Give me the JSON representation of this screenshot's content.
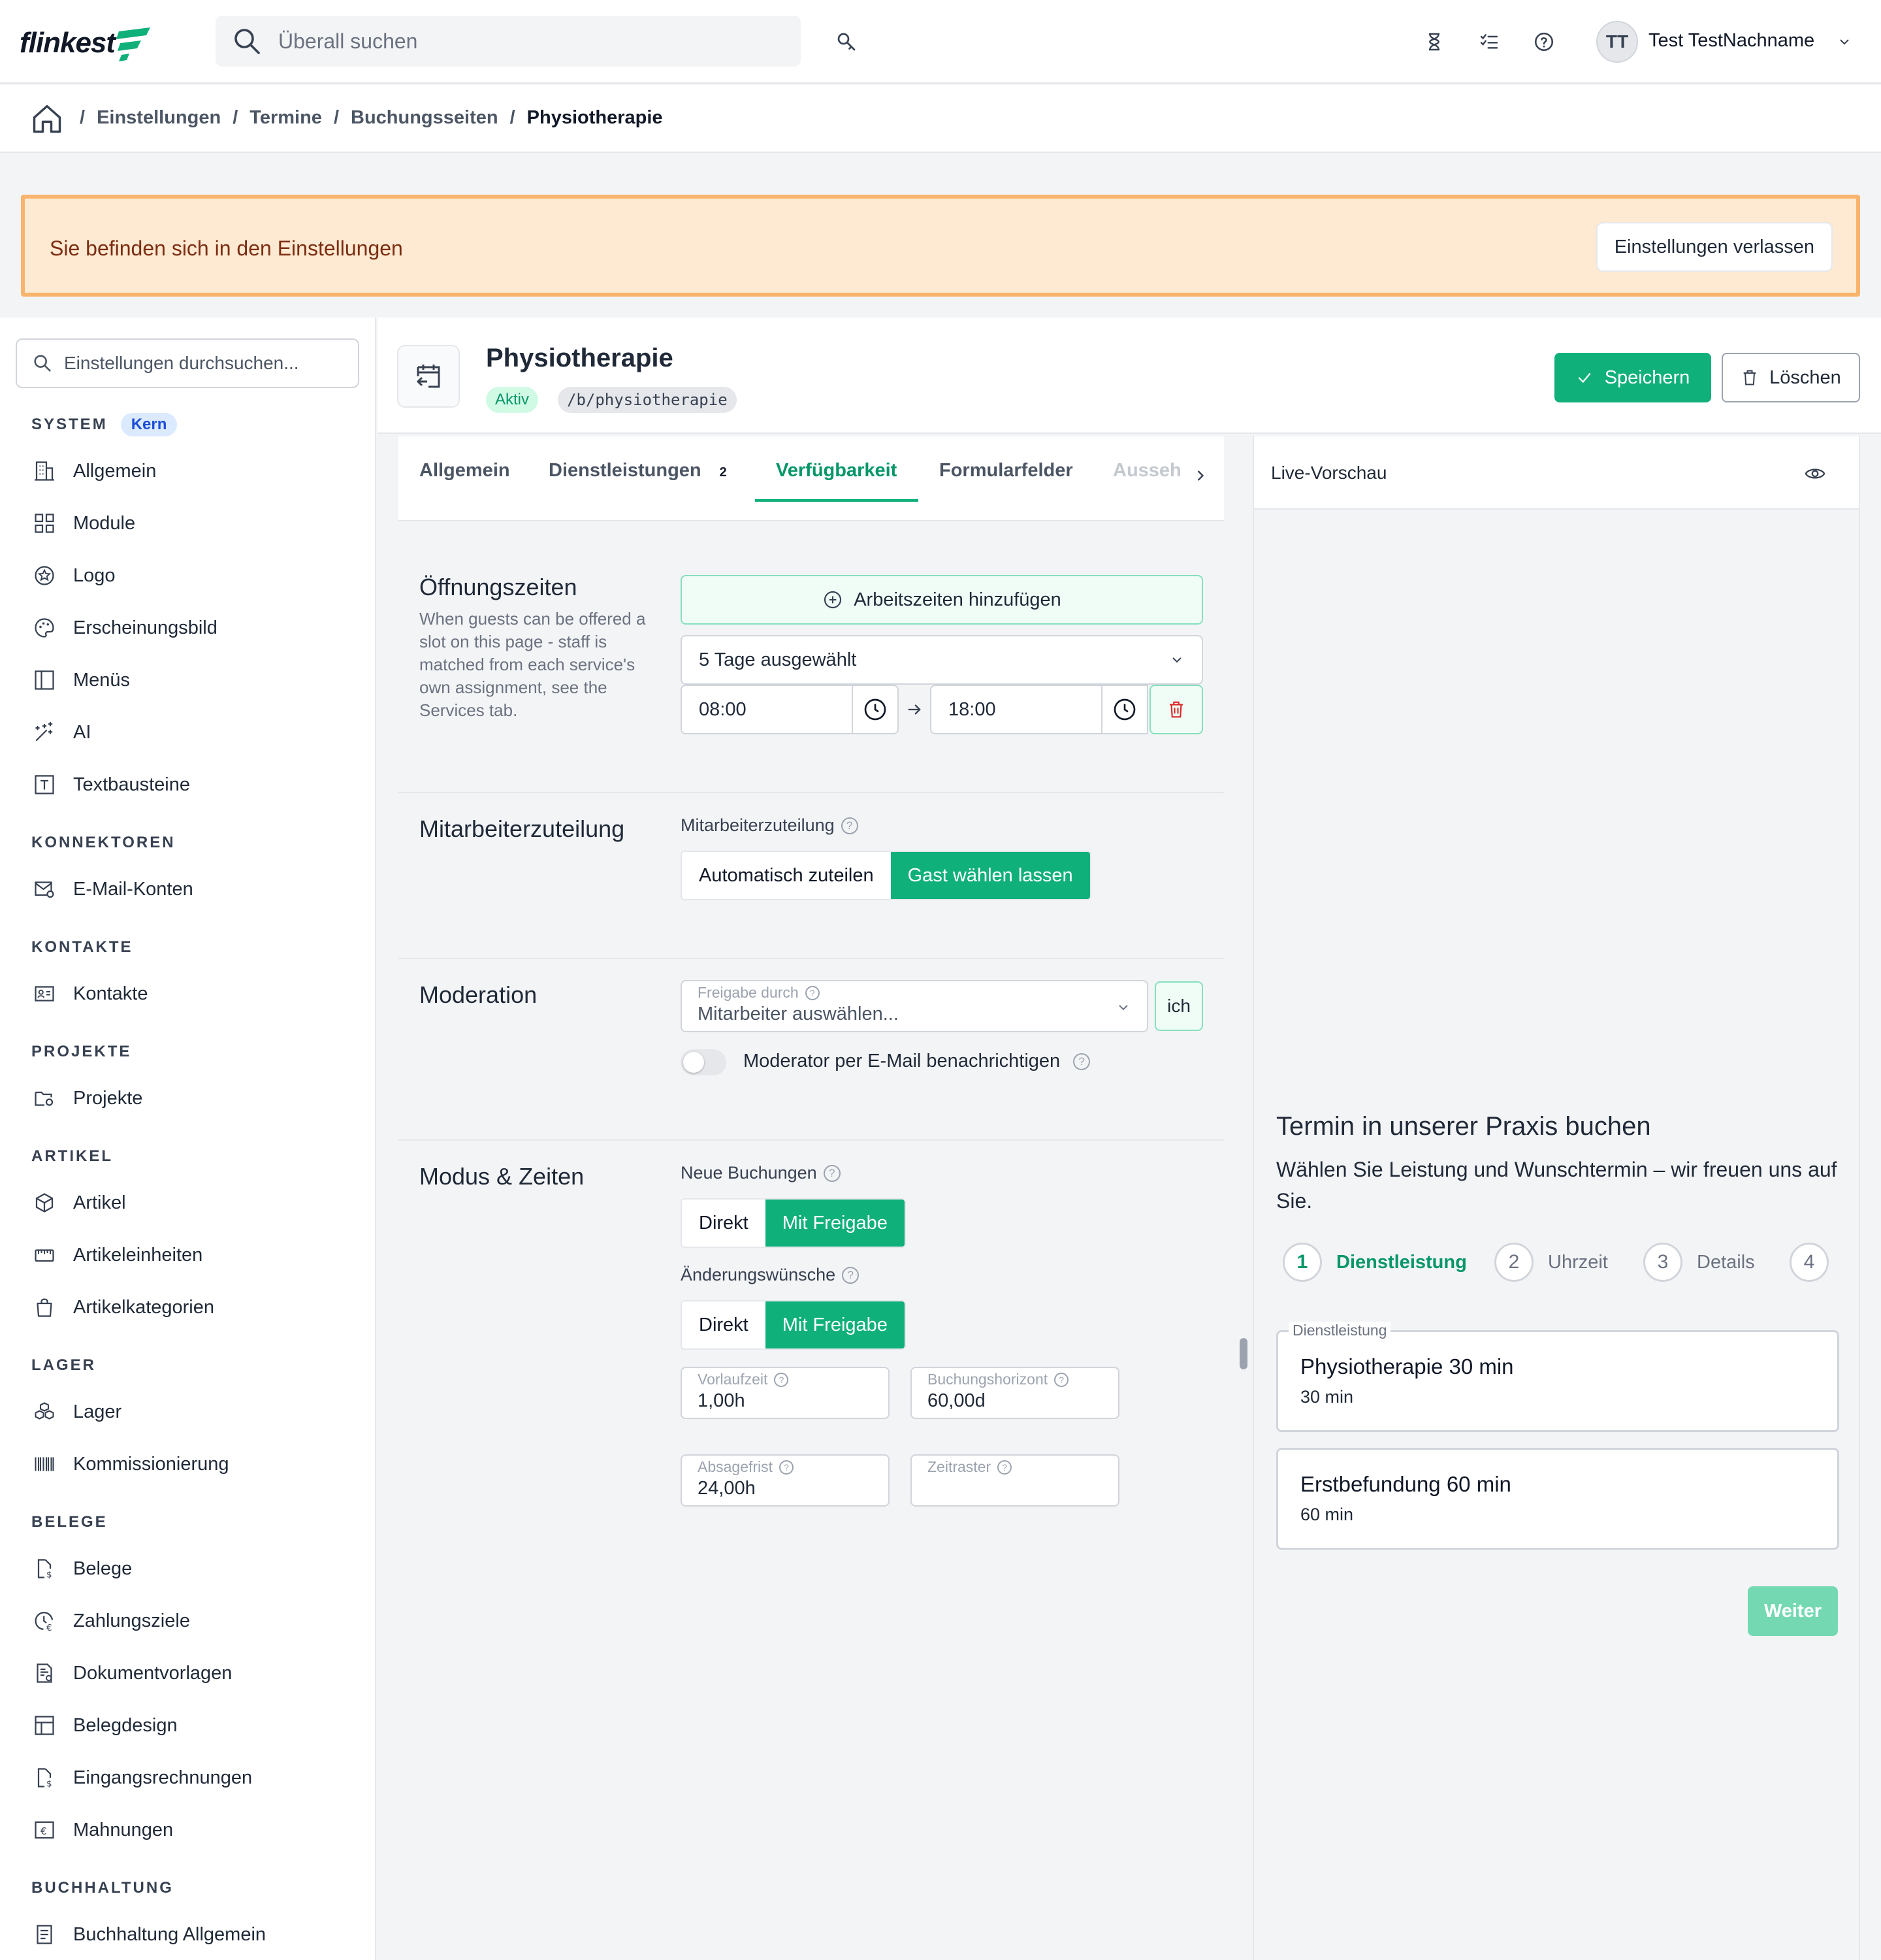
{
  "app": {
    "logo_text": "flinkest",
    "logo_accent_color": "#10b07b"
  },
  "topbar": {
    "search_placeholder": "Überall suchen",
    "icons": [
      "search-icon",
      "key-search-icon",
      "hourglass-icon",
      "checklist-icon",
      "help-icon",
      "chevron-down-icon"
    ],
    "user": {
      "initials": "TT",
      "name": "Test TestNachname"
    }
  },
  "breadcrumb": {
    "separator": "/",
    "items": [
      "Einstellungen",
      "Termine",
      "Buchungsseiten"
    ],
    "current": "Physiotherapie"
  },
  "alert": {
    "text": "Sie befinden sich in den Einstellungen",
    "button": "Einstellungen verlassen"
  },
  "sidebar": {
    "search_placeholder": "Einstellungen durchsuchen...",
    "sections": [
      {
        "title": "SYSTEM",
        "badge": "Kern",
        "items": [
          "Allgemein",
          "Module",
          "Logo",
          "Erscheinungsbild",
          "Menüs",
          "AI",
          "Textbausteine"
        ]
      },
      {
        "title": "KONNEKTOREN",
        "items": [
          "E-Mail-Konten"
        ]
      },
      {
        "title": "KONTAKTE",
        "items": [
          "Kontakte"
        ]
      },
      {
        "title": "PROJEKTE",
        "items": [
          "Projekte"
        ]
      },
      {
        "title": "ARTIKEL",
        "items": [
          "Artikel",
          "Artikeleinheiten",
          "Artikelkategorien"
        ]
      },
      {
        "title": "LAGER",
        "items": [
          "Lager",
          "Kommissionierung"
        ]
      },
      {
        "title": "BELEGE",
        "items": [
          "Belege",
          "Zahlungsziele",
          "Dokumentvorlagen",
          "Belegdesign",
          "Eingangsrechnungen",
          "Mahnungen"
        ]
      },
      {
        "title": "BUCHHALTUNG",
        "items": [
          "Buchhaltung Allgemein"
        ]
      }
    ]
  },
  "page": {
    "title": "Physiotherapie",
    "status": "Aktiv",
    "slug": "/b/physiotherapie",
    "save": "Speichern",
    "delete": "Löschen"
  },
  "tabs": {
    "items": [
      {
        "label": "Allgemein"
      },
      {
        "label": "Dienstleistungen",
        "count": "2"
      },
      {
        "label": "Verfügbarkeit",
        "active": true
      },
      {
        "label": "Formularfelder"
      },
      {
        "label": "Ausseh"
      }
    ]
  },
  "opening": {
    "title": "Öffnungszeiten",
    "desc": "When guests can be offered a slot on this page - staff is matched from each service's own assignment, see the Services tab.",
    "add_button": "Arbeitszeiten hinzufügen",
    "days": "5 Tage ausgewählt",
    "from": "08:00",
    "to": "18:00"
  },
  "staff": {
    "title": "Mitarbeiterzuteilung",
    "label": "Mitarbeiterzuteilung",
    "options": [
      "Automatisch zuteilen",
      "Gast wählen lassen"
    ],
    "selected": "Gast wählen lassen"
  },
  "moderation": {
    "title": "Moderation",
    "field_label": "Freigabe durch",
    "field_placeholder": "Mitarbeiter auswählen...",
    "me_button": "ich",
    "toggle_label": "Moderator per E-Mail benachrichtigen",
    "toggle_on": false
  },
  "modes": {
    "title": "Modus & Zeiten",
    "new_label": "Neue Buchungen",
    "new_options": [
      "Direkt",
      "Mit Freigabe"
    ],
    "change_label": "Änderungswünsche",
    "change_options": [
      "Direkt",
      "Mit Freigabe"
    ],
    "selected": "Mit Freigabe",
    "fields": [
      {
        "label": "Vorlaufzeit",
        "value": "1,00h"
      },
      {
        "label": "Buchungshorizont",
        "value": "60,00d"
      },
      {
        "label": "Absagefrist",
        "value": "24,00h"
      },
      {
        "label": "Zeitraster",
        "value": ""
      }
    ]
  },
  "preview": {
    "title": "Live-Vorschau",
    "heading": "Termin in unserer Praxis buchen",
    "subheading": "Wählen Sie Leistung und Wunschtermin – wir freuen uns auf Sie.",
    "steps": [
      {
        "n": "1",
        "label": "Dienstleistung"
      },
      {
        "n": "2",
        "label": "Uhrzeit"
      },
      {
        "n": "3",
        "label": "Details"
      },
      {
        "n": "4",
        "label": ""
      }
    ],
    "service_legend": "Dienstleistung",
    "services": [
      {
        "name": "Physiotherapie 30 min",
        "duration": "30 min"
      },
      {
        "name": "Erstbefundung 60 min",
        "duration": "60 min"
      }
    ],
    "next": "Weiter"
  }
}
